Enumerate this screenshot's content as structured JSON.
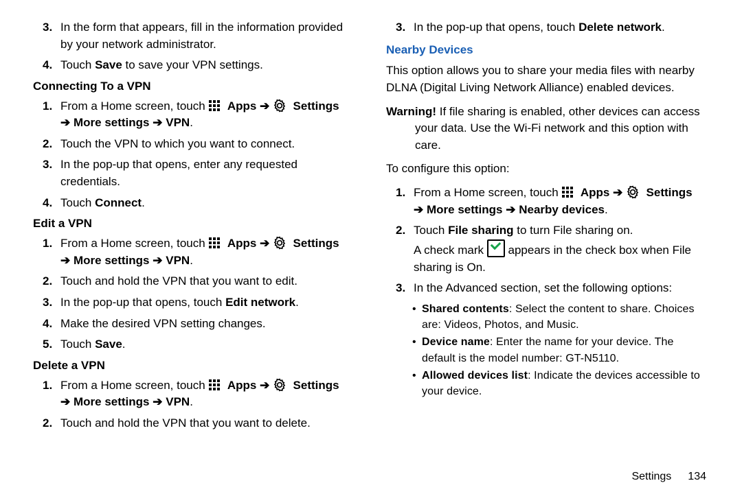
{
  "arrow": "➔",
  "left": {
    "intro3": {
      "num": "3.",
      "text_a": "In the form that appears, fill in the information provided by your network administrator."
    },
    "intro4": {
      "num": "4.",
      "pre": "Touch ",
      "b": "Save",
      "post": " to save your VPN settings."
    },
    "connHead": "Connecting To a VPN",
    "c1": {
      "num": "1.",
      "pre": "From a Home screen, touch ",
      "apps": "Apps",
      "settings": "Settings",
      "line2a": "More settings",
      "line2b": "VPN",
      "dot": "."
    },
    "c2": {
      "num": "2.",
      "text": "Touch the VPN to which you want to connect."
    },
    "c3": {
      "num": "3.",
      "text": "In the pop-up that opens, enter any requested credentials."
    },
    "c4": {
      "num": "4.",
      "pre": "Touch ",
      "b": "Connect",
      "post": "."
    },
    "editHead": "Edit a VPN",
    "e1": {
      "num": "1.",
      "pre": "From a Home screen, touch ",
      "apps": "Apps",
      "settings": "Settings",
      "line2a": "More settings",
      "line2b": "VPN",
      "dot": "."
    },
    "e2": {
      "num": "2.",
      "text": "Touch and hold the VPN that you want to edit."
    },
    "e3": {
      "num": "3.",
      "pre": "In the pop-up that opens, touch ",
      "b": "Edit network",
      "post": "."
    },
    "e4": {
      "num": "4.",
      "text": "Make the desired VPN setting changes."
    },
    "e5": {
      "num": "5.",
      "pre": "Touch ",
      "b": "Save",
      "post": "."
    },
    "delHead": "Delete a VPN",
    "d1": {
      "num": "1.",
      "pre": "From a Home screen, touch ",
      "apps": "Apps",
      "settings": "Settings",
      "line2a": "More settings",
      "line2b": "VPN",
      "dot": "."
    },
    "d2": {
      "num": "2.",
      "text": "Touch and hold the VPN that you want to delete."
    }
  },
  "right": {
    "r3": {
      "num": "3.",
      "pre": "In the pop-up that opens, touch ",
      "b": "Delete network",
      "post": "."
    },
    "sect": "Nearby Devices",
    "p1": "This option allows you to share your media files with nearby DLNA (Digital Living Network Alliance) enabled devices.",
    "warnL": "Warning!",
    "warnT": " If file sharing is enabled, other devices can access your data. Use the Wi-Fi network and this option with care.",
    "p2": "To configure this option:",
    "n1": {
      "num": "1.",
      "pre": "From a Home screen, touch ",
      "apps": "Apps",
      "settings": "Settings",
      "line2a": "More settings",
      "line2b": "Nearby devices",
      "dot": "."
    },
    "n2": {
      "num": "2.",
      "pre": "Touch ",
      "b": "File sharing",
      "post": " to turn File sharing on.",
      "extraA": "A check mark ",
      "extraB": " appears in the check box when File sharing is On."
    },
    "n3": {
      "num": "3.",
      "text": "In the Advanced section, set the following options:"
    },
    "b1": {
      "b": "Shared contents",
      "t": ": Select the content to share. Choices are: Videos, Photos, and Music."
    },
    "b2": {
      "b": "Device name",
      "t": ": Enter the name for your device. The default is the model number: GT-N5110."
    },
    "b3": {
      "b": "Allowed devices list",
      "t": ": Indicate the devices accessible to your device."
    }
  },
  "footer": {
    "label": "Settings",
    "page": "134"
  }
}
